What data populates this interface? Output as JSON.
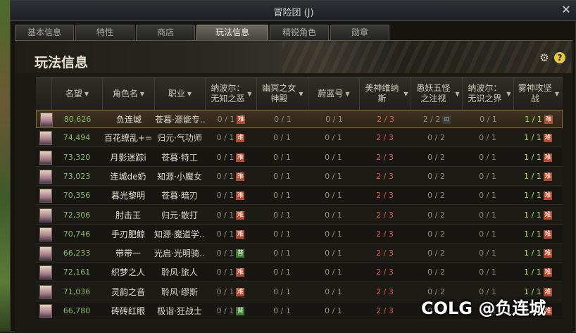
{
  "window": {
    "title": "冒险团 (J)",
    "close_glyph": "✕"
  },
  "tabs": [
    {
      "label": "基本信息",
      "active": false
    },
    {
      "label": "特性",
      "active": false
    },
    {
      "label": "商店",
      "active": false
    },
    {
      "label": "玩法信息",
      "active": true
    },
    {
      "label": "精锐角色",
      "active": false
    },
    {
      "label": "勋章",
      "active": false
    }
  ],
  "panel": {
    "title": "玩法信息",
    "gear_glyph": "⚙",
    "help_glyph": "?"
  },
  "columns": [
    {
      "label": "名望"
    },
    {
      "label": "角色名"
    },
    {
      "label": "职业"
    },
    {
      "label": "纳波尔：无知之恶"
    },
    {
      "label": "幽冥之女神殿"
    },
    {
      "label": "蔚蓝号"
    },
    {
      "label": "美神维纳斯"
    },
    {
      "label": "愚妖五怪之注视"
    },
    {
      "label": "纳波尔：无识之界"
    },
    {
      "label": "雾神攻坚战"
    }
  ],
  "rows": [
    {
      "fame": "80,626",
      "name": "负连城",
      "job": "苍暮·源能专…",
      "c1": "0 / 1",
      "c1b": "难",
      "c2": "0 / 1",
      "c3": "0 / 1",
      "c4": "2 / 3",
      "c5": "2 / 2",
      "c5b": "⊡",
      "c6": "0 / 1",
      "c7": "1 / 1",
      "c7b": "难"
    },
    {
      "fame": "74,494",
      "name": "百花缭乱+=",
      "job": "归元·气功师",
      "c1": "0 / 1",
      "c1b": "难",
      "c2": "0 / 1",
      "c3": "0 / 1",
      "c4": "2 / 3",
      "c5": "0 / 2",
      "c6": "0 / 1",
      "c7": "1 / 1",
      "c7b": "难"
    },
    {
      "fame": "73,320",
      "name": "月影迷踪i",
      "job": "苍暮·特工",
      "c1": "0 / 1",
      "c1b": "难",
      "c2": "0 / 1",
      "c3": "0 / 1",
      "c4": "2 / 3",
      "c5": "0 / 2",
      "c6": "0 / 1",
      "c7": "1 / 1",
      "c7b": "难"
    },
    {
      "fame": "73,023",
      "name": "连城de奶",
      "job": "知源·小魔女",
      "c1": "0 / 1",
      "c1b": "难",
      "c2": "0 / 1",
      "c3": "0 / 1",
      "c4": "2 / 3",
      "c5": "0 / 2",
      "c6": "0 / 1",
      "c7": "1 / 1",
      "c7b": "难"
    },
    {
      "fame": "70,356",
      "name": "暮光黎明",
      "job": "苍暮·暗刃",
      "c1": "0 / 1",
      "c1b": "难",
      "c2": "0 / 1",
      "c3": "0 / 1",
      "c4": "2 / 3",
      "c5": "0 / 2",
      "c6": "0 / 1",
      "c7": "1 / 1",
      "c7b": "难"
    },
    {
      "fame": "72,306",
      "name": "肘击王",
      "job": "归元·散打",
      "c1": "0 / 1",
      "c1b": "难",
      "c2": "0 / 1",
      "c3": "0 / 1",
      "c4": "2 / 3",
      "c5": "0 / 2",
      "c6": "0 / 1",
      "c7": "1 / 1",
      "c7b": "难"
    },
    {
      "fame": "70,746",
      "name": "手刃肥鲸",
      "job": "知源·魔道学…",
      "c1": "0 / 1",
      "c1b": "难",
      "c2": "0 / 1",
      "c3": "0 / 1",
      "c4": "2 / 3",
      "c5": "0 / 2",
      "c6": "0 / 1",
      "c7": "1 / 1",
      "c7b": "难"
    },
    {
      "fame": "66,233",
      "name": "带带一",
      "job": "光启·光明骑…",
      "c1": "0 / 1",
      "c1b": "普",
      "c2": "0 / 1",
      "c3": "0 / 1",
      "c4": "2 / 3",
      "c5": "0 / 2",
      "c6": "0 / 1",
      "c7": "1 / 1",
      "c7b": "难"
    },
    {
      "fame": "72,161",
      "name": "织梦之人",
      "job": "聆风·旅人",
      "c1": "0 / 1",
      "c1b": "难",
      "c2": "0 / 1",
      "c3": "0 / 1",
      "c4": "2 / 3",
      "c5": "0 / 2",
      "c6": "0 / 1",
      "c7": "1 / 1",
      "c7b": "难"
    },
    {
      "fame": "71,036",
      "name": "灵韵之音",
      "job": "聆风·缪斯",
      "c1": "0 / 1",
      "c1b": "难",
      "c2": "0 / 1",
      "c3": "0 / 1",
      "c4": "2 / 3",
      "c5": "0 / 2",
      "c6": "0 / 1",
      "c7": "1 / 1",
      "c7b": "难"
    },
    {
      "fame": "66,780",
      "name": "砖砖红眼",
      "job": "极诣·狂战士",
      "c1": "0 / 1",
      "c1b": "普",
      "c2": "0 / 1",
      "c3": "0 / 1",
      "c4": "2 / 3",
      "c5": "0 / 2",
      "c6": "0 / 1",
      "c7": "1 / 1",
      "c7b": "难"
    }
  ],
  "watermark": "COLG @负连城"
}
